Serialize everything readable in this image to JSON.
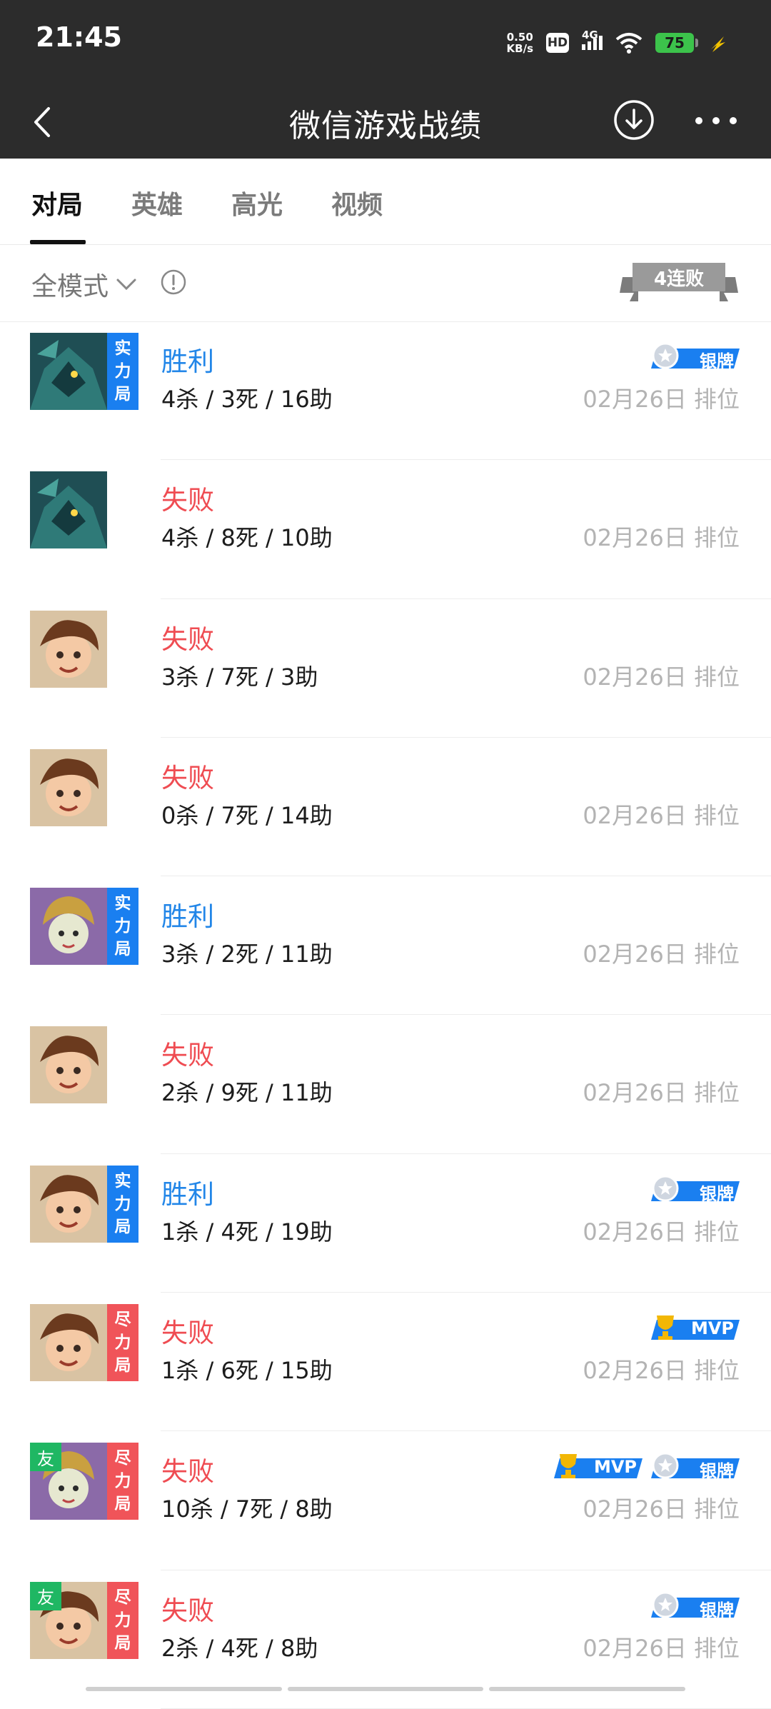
{
  "status": {
    "time": "21:45",
    "net_speed_value": "0.50",
    "net_speed_unit": "KB/s",
    "hd": "HD",
    "network": "4G",
    "battery": "75"
  },
  "nav": {
    "title": "微信游戏战绩"
  },
  "tabs": [
    {
      "label": "对局",
      "active": true
    },
    {
      "label": "英雄",
      "active": false
    },
    {
      "label": "高光",
      "active": false
    },
    {
      "label": "视频",
      "active": false
    }
  ],
  "filter": {
    "mode": "全模式",
    "streak": "4连败"
  },
  "colors": {
    "win": "#2286e8",
    "lose": "#ef4c52",
    "strength_tag": "#1a7ff0",
    "effort_tag": "#f05459",
    "friend_tag": "#1fb763",
    "mvp_trophy": "#f2b705"
  },
  "tag_text": {
    "strength": [
      "实",
      "力",
      "局"
    ],
    "effort": [
      "尽",
      "力",
      "局"
    ],
    "friend": "友"
  },
  "badge_text": {
    "silver": "银牌",
    "mvp": "MVP"
  },
  "matches": [
    {
      "hero": "teal-armored-hero",
      "result": "胜利",
      "win": true,
      "kda": "4杀 / 3死 / 16助",
      "date": "02月26日 排位",
      "tag": "strength",
      "friend": false,
      "badges": [
        "silver"
      ]
    },
    {
      "hero": "teal-armored-hero",
      "result": "失败",
      "win": false,
      "kda": "4杀 / 8死 / 10助",
      "date": "02月26日 排位",
      "tag": null,
      "friend": false,
      "badges": []
    },
    {
      "hero": "brown-hair-boy-hero",
      "result": "失败",
      "win": false,
      "kda": "3杀 / 7死 / 3助",
      "date": "02月26日 排位",
      "tag": null,
      "friend": false,
      "badges": []
    },
    {
      "hero": "brown-hair-boy-hero",
      "result": "失败",
      "win": false,
      "kda": "0杀 / 7死 / 14助",
      "date": "02月26日 排位",
      "tag": null,
      "friend": false,
      "badges": []
    },
    {
      "hero": "helmet-girl-hero",
      "result": "胜利",
      "win": true,
      "kda": "3杀 / 2死 / 11助",
      "date": "02月26日 排位",
      "tag": "strength",
      "friend": false,
      "badges": []
    },
    {
      "hero": "brown-hair-boy-hero",
      "result": "失败",
      "win": false,
      "kda": "2杀 / 9死 / 11助",
      "date": "02月26日 排位",
      "tag": null,
      "friend": false,
      "badges": []
    },
    {
      "hero": "brown-hair-boy-hero",
      "result": "胜利",
      "win": true,
      "kda": "1杀 / 4死 / 19助",
      "date": "02月26日 排位",
      "tag": "strength",
      "friend": false,
      "badges": [
        "silver"
      ]
    },
    {
      "hero": "brown-hair-boy-hero",
      "result": "失败",
      "win": false,
      "kda": "1杀 / 6死 / 15助",
      "date": "02月26日 排位",
      "tag": "effort",
      "friend": false,
      "badges": [
        "mvp"
      ]
    },
    {
      "hero": "helmet-girl-hero",
      "result": "失败",
      "win": false,
      "kda": "10杀 / 7死 / 8助",
      "date": "02月26日 排位",
      "tag": "effort",
      "friend": true,
      "badges": [
        "mvp",
        "silver"
      ]
    },
    {
      "hero": "brown-hair-boy-hero",
      "result": "失败",
      "win": false,
      "kda": "2杀 / 4死 / 8助",
      "date": "02月26日 排位",
      "tag": "effort",
      "friend": true,
      "badges": [
        "silver"
      ]
    }
  ]
}
